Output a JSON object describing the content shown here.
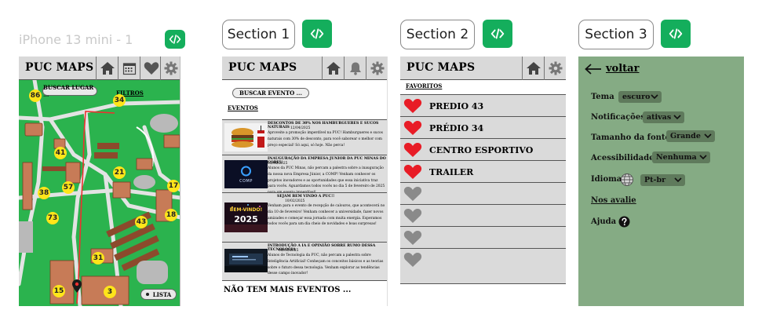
{
  "canvas": {
    "frame_label": "iPhone 13 mini - 1",
    "sections": [
      "Section 1",
      "Section 2",
      "Section 3"
    ]
  },
  "colors": {
    "brand_green": "#14ae5c",
    "map_green": "#2bb34e",
    "settings_green": "#85ab84",
    "header_gray": "#d9d9d9",
    "heart_red": "#e81c26",
    "heart_gray": "#8a8a8a"
  },
  "app": {
    "title": "PUC MAPS"
  },
  "map_screen": {
    "search_label": "BUSCAR LUGAR ...",
    "filter_label": "FILTROS",
    "list_label": "LISTA",
    "icons": [
      "home-icon",
      "calendar-icon",
      "heart-icon",
      "gear-icon"
    ],
    "pins": [
      "86",
      "34",
      "41",
      "21",
      "17",
      "38",
      "57",
      "73",
      "43",
      "18",
      "31",
      "15",
      "3"
    ]
  },
  "events_screen": {
    "search_label": "BUSCAR EVENTO ...",
    "section_title": "EVENTOS",
    "icons": [
      "home-icon",
      "bell-icon",
      "gear-icon"
    ],
    "events": [
      {
        "title": "DESCONTOS DE 30% NOS HAMBURGUERES E SUCOS NATURAIS",
        "date": "12/04/2025",
        "body": "Aproveite a promoção imperdível na PUC! Hamburgueres e sucos naturais com 30% de desconto, para você saborear o melhor com preço especial! Só aqui, só hoje. Não perca!"
      },
      {
        "title": "INAUGURAÇÃO DA EMPRESA JUNIOR DA PUC MINAS DO COREU",
        "date": "05/05/2025",
        "body": "Alunos da PUC Minas, não percam a palestra sobre a inauguração da nossa nova Empresa Júnior, a COMP! Venham conhecer os projetos inovadores e as oportunidades que essa iniciativa traz para vocês. Aguardamos todos vocês no dia 5 de fevereiro de 2025 para um evento imperdível!",
        "image_text": "COMP"
      },
      {
        "title": "SEJAM BEM VINDO A PUC!!",
        "date": "10/02/2025",
        "body": "Venham para o evento de recepção de calouros, que acontecerá no dia 10 de fevereiro! Venham conhecer a universidade, fazer novos amizades e começar essa jornada com muita energia. Esperamos todos vocês para um dia cheio de novidades e boas surpresas!",
        "image_text_top": "BEM-VINDO!",
        "image_text_bottom": "2025"
      },
      {
        "title": "INTRODUÇÃO A IA E OPINIÃO SOBRE RUMO DESSA TECNOLOGIA",
        "date": "08/05/2025",
        "body": "Alunos de Tecnologia da PUC, não percam a palestra sobre Inteligência Artificial! Conheçam os conceitos básicos e as teorias sobre o futuro dessa tecnologia. Venham explorar as tendências desse campo inovador!"
      }
    ],
    "footer": "NÃO TEM MAIS EVENTOS ..."
  },
  "favorites_screen": {
    "section_title": "FAVORITOS",
    "icons": [
      "home-icon",
      "gear-icon"
    ],
    "items": [
      "PREDIO 43",
      "PRÉDIO 34",
      "CENTRO ESPORTIVO",
      "TRAILER",
      "",
      "",
      "",
      ""
    ]
  },
  "settings_screen": {
    "back_label": "voltar",
    "theme_label": "Tema",
    "theme_value": "escuro",
    "notifications_label": "Notificações",
    "notifications_value": "ativas",
    "font_size_label": "Tamanho da fonte",
    "font_size_value": "Grande",
    "accessibility_label": "Acessibilidade",
    "accessibility_value": "Nenhuma",
    "language_label": "Idioma",
    "language_value": "Pt-br",
    "rate_label": "Nos avalie",
    "help_label": "Ajuda"
  }
}
